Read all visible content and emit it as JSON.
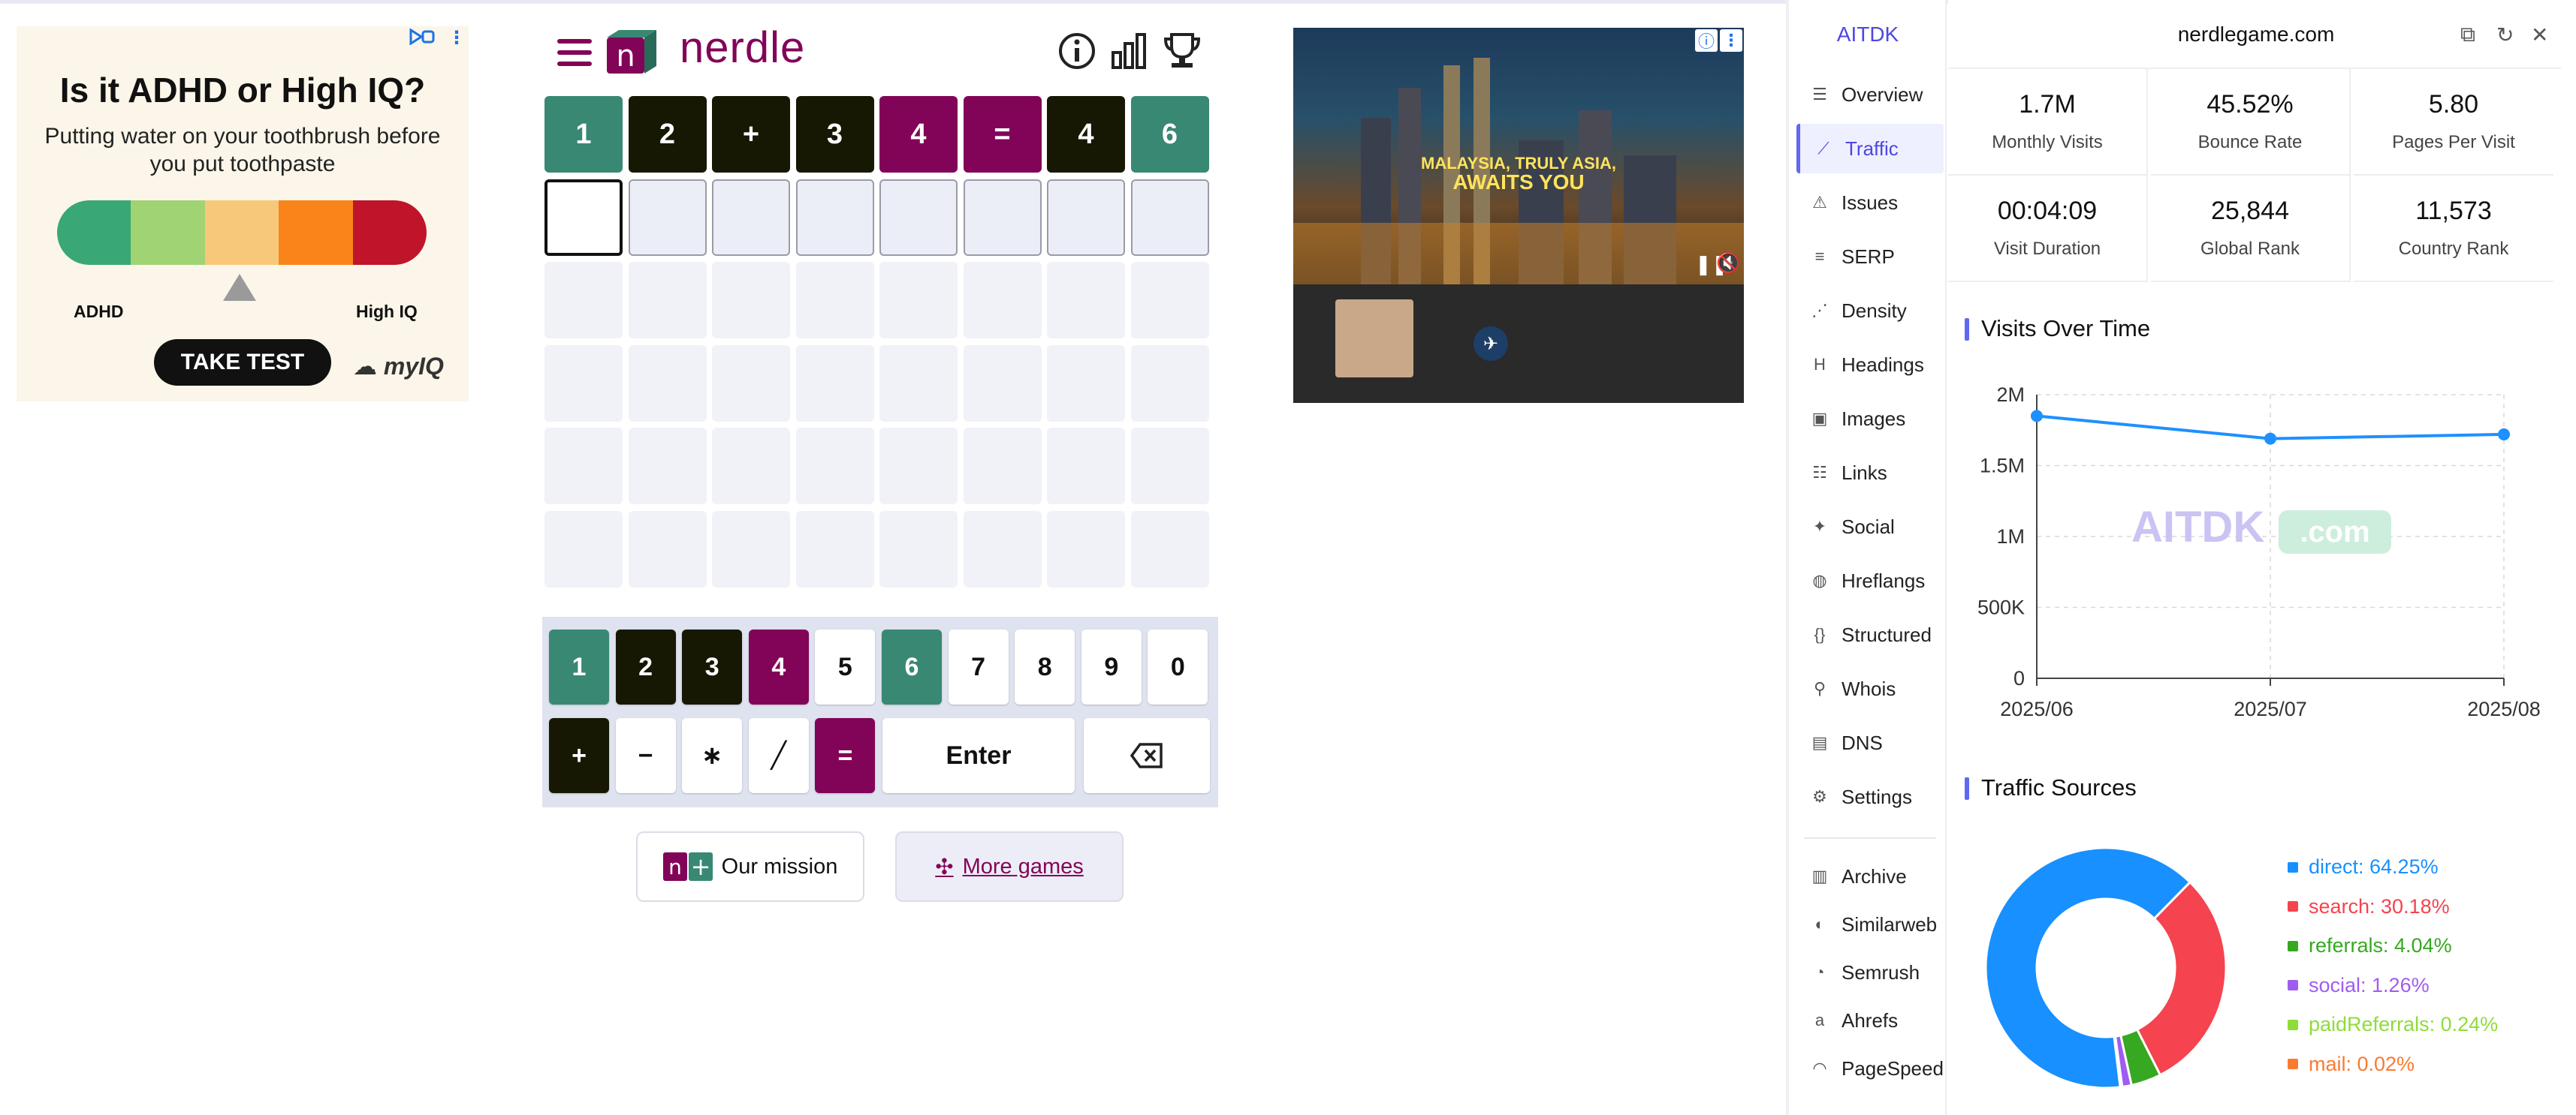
{
  "left_ad": {
    "title": "Is it ADHD or High IQ?",
    "subtitle": "Putting water on your toothbrush before you put toothpaste",
    "label_left": "ADHD",
    "label_right": "High IQ",
    "cta": "TAKE TEST",
    "brand": "myIQ",
    "meter_colors": [
      "#3aa776",
      "#9fd373",
      "#f8c87a",
      "#f9851a",
      "#c0142b"
    ]
  },
  "nerdle": {
    "logo_word": "nerdle",
    "brand_color": "#820458",
    "icons": [
      "info-icon",
      "stats-icon",
      "trophy-icon"
    ],
    "guess_row": [
      {
        "v": "1",
        "s": "green"
      },
      {
        "v": "2",
        "s": "black"
      },
      {
        "v": "+",
        "s": "black"
      },
      {
        "v": "3",
        "s": "black"
      },
      {
        "v": "4",
        "s": "purple"
      },
      {
        "v": "=",
        "s": "purple"
      },
      {
        "v": "4",
        "s": "black"
      },
      {
        "v": "6",
        "s": "green"
      }
    ],
    "keys_row1": [
      {
        "v": "1",
        "s": "green"
      },
      {
        "v": "2",
        "s": "black"
      },
      {
        "v": "3",
        "s": "black"
      },
      {
        "v": "4",
        "s": "purple"
      },
      {
        "v": "5",
        "s": "plain"
      },
      {
        "v": "6",
        "s": "green"
      },
      {
        "v": "7",
        "s": "plain"
      },
      {
        "v": "8",
        "s": "plain"
      },
      {
        "v": "9",
        "s": "plain"
      },
      {
        "v": "0",
        "s": "plain"
      }
    ],
    "keys_row2": [
      {
        "v": "+",
        "s": "black"
      },
      {
        "v": "−",
        "s": "plain"
      },
      {
        "v": "∗",
        "s": "plain"
      },
      {
        "v": "╱",
        "s": "plain"
      },
      {
        "v": "=",
        "s": "purple"
      }
    ],
    "enter_label": "Enter",
    "mission_label": "Our mission",
    "more_games_label": "More games"
  },
  "video_ad": {
    "headline_1": "MALAYSIA, TRULY ASIA,",
    "headline_2": "AWAITS YOU"
  },
  "panel": {
    "brand": "AITDK",
    "domain": "nerdlegame.com",
    "nav": [
      {
        "label": "Overview",
        "icon": "overview-icon",
        "glyph": "☰"
      },
      {
        "label": "Traffic",
        "icon": "traffic-icon",
        "glyph": "⟋",
        "active": true
      },
      {
        "label": "Issues",
        "icon": "issues-icon",
        "glyph": "⚠"
      },
      {
        "label": "SERP",
        "icon": "serp-icon",
        "glyph": "≡"
      },
      {
        "label": "Density",
        "icon": "density-icon",
        "glyph": "⋰"
      },
      {
        "label": "Headings",
        "icon": "headings-icon",
        "glyph": "H"
      },
      {
        "label": "Images",
        "icon": "images-icon",
        "glyph": "▣"
      },
      {
        "label": "Links",
        "icon": "links-icon",
        "glyph": "☷"
      },
      {
        "label": "Social",
        "icon": "social-icon",
        "glyph": "✦"
      },
      {
        "label": "Hreflangs",
        "icon": "hreflangs-icon",
        "glyph": "◍"
      },
      {
        "label": "Structured",
        "icon": "structured-icon",
        "glyph": "{}"
      },
      {
        "label": "Whois",
        "icon": "whois-icon",
        "glyph": "⚲"
      },
      {
        "label": "DNS",
        "icon": "dns-icon",
        "glyph": "▤"
      },
      {
        "label": "Settings",
        "icon": "settings-icon",
        "glyph": "⚙"
      }
    ],
    "tools": [
      {
        "label": "Archive",
        "icon": "archive-icon",
        "glyph": "▥"
      },
      {
        "label": "Similarweb",
        "icon": "similarweb-icon",
        "glyph": "◐"
      },
      {
        "label": "Semrush",
        "icon": "semrush-icon",
        "glyph": "◔"
      },
      {
        "label": "Ahrefs",
        "icon": "ahrefs-icon",
        "glyph": "a"
      },
      {
        "label": "PageSpeed",
        "icon": "pagespeed-icon",
        "glyph": "◠"
      }
    ],
    "stats": [
      {
        "value": "1.7M",
        "label": "Monthly Visits"
      },
      {
        "value": "45.52%",
        "label": "Bounce Rate"
      },
      {
        "value": "5.80",
        "label": "Pages Per Visit"
      },
      {
        "value": "00:04:09",
        "label": "Visit Duration"
      },
      {
        "value": "25,844",
        "label": "Global Rank"
      },
      {
        "value": "11,573",
        "label": "Country Rank"
      }
    ],
    "visits_title": "Visits Over Time",
    "watermark": "AITDK",
    "watermark_suffix": ".com",
    "sources_title": "Traffic Sources"
  },
  "chart_data": [
    {
      "type": "line",
      "x": [
        "2025/06",
        "2025/07",
        "2025/08"
      ],
      "series": [
        {
          "values": [
            1850000,
            1690000,
            1720000
          ]
        }
      ],
      "yticks": [
        "0",
        "500K",
        "1M",
        "1.5M",
        "2M"
      ],
      "ylim": [
        0,
        2000000
      ],
      "grid": true,
      "color": "#1e90ff"
    },
    {
      "type": "pie",
      "labels": [
        "direct",
        "search",
        "referrals",
        "social",
        "paidReferrals",
        "mail"
      ],
      "values": [
        64.25,
        30.18,
        4.04,
        1.26,
        0.24,
        0.02
      ],
      "legend_text": [
        "direct: 64.25%",
        "search: 30.18%",
        "referrals: 4.04%",
        "social: 1.26%",
        "paidReferrals: 0.24%",
        "mail: 0.02%"
      ],
      "colors": [
        "#1890ff",
        "#f5434f",
        "#36a821",
        "#a05cf0",
        "#8fdc3a",
        "#fa7a30"
      ],
      "legend": "right"
    }
  ]
}
